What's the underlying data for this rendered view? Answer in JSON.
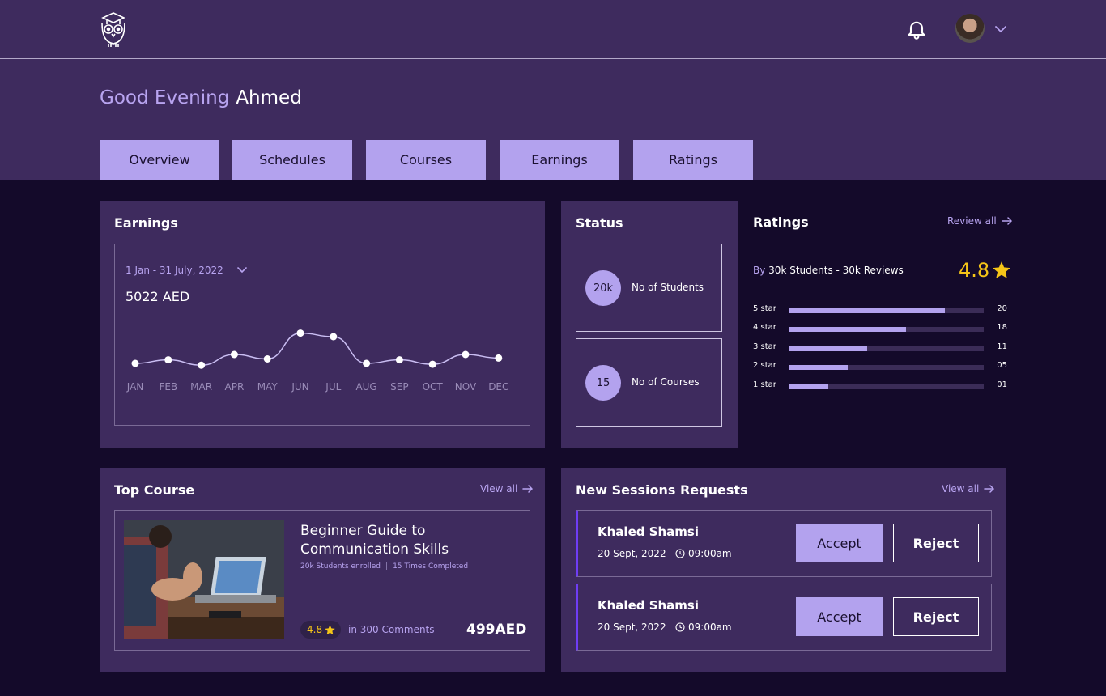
{
  "header": {
    "logo_icon": "owl-graduation-cap-logo",
    "notification_icon": "bell-icon",
    "user_menu_icon": "chevron-down-icon"
  },
  "greeting": {
    "salutation": "Good Evening",
    "name": "Ahmed"
  },
  "tabs": [
    {
      "label": "Overview"
    },
    {
      "label": "Schedules"
    },
    {
      "label": "Courses"
    },
    {
      "label": "Earnings"
    },
    {
      "label": "Ratings"
    }
  ],
  "earnings": {
    "title": "Earnings",
    "date_range": "1 Jan - 31 July, 2022",
    "total": "5022 AED"
  },
  "chart_data": {
    "type": "line",
    "title": "",
    "xlabel": "",
    "ylabel": "",
    "categories": [
      "JAN",
      "FEB",
      "MAR",
      "APR",
      "MAY",
      "JUN",
      "JUL",
      "AUG",
      "SEP",
      "OCT",
      "NOV",
      "DEC"
    ],
    "series": [
      {
        "values": [
          10,
          14,
          8,
          20,
          15,
          44,
          40,
          10,
          14,
          9,
          20,
          16
        ]
      }
    ],
    "ylim": [
      0,
      50
    ],
    "grid": false,
    "line_color": "#c9bdf2",
    "point_color": "#ffffff"
  },
  "status": {
    "title": "Status",
    "items": [
      {
        "value": "20k",
        "label": "No of Students"
      },
      {
        "value": "15",
        "label": "No of Courses"
      }
    ]
  },
  "ratings": {
    "title": "Ratings",
    "review_all": "Review all",
    "by_prefix": "By",
    "by_text": "30k Students - 30k Reviews",
    "score": "4.8",
    "rows": [
      {
        "label": "5 star",
        "fraction": 0.8,
        "count": "20"
      },
      {
        "label": "4 star",
        "fraction": 0.6,
        "count": "18"
      },
      {
        "label": "3 star",
        "fraction": 0.4,
        "count": "11"
      },
      {
        "label": "2 star",
        "fraction": 0.3,
        "count": "05"
      },
      {
        "label": "1 star",
        "fraction": 0.2,
        "count": "01"
      }
    ]
  },
  "top_course": {
    "title": "Top Course",
    "view_all": "View all",
    "course_title": "Beginner Guide to Communication Skills",
    "enrolled": "20k Students enrolled",
    "separator": "|",
    "completed": "15 Times Completed",
    "rating": "4.8",
    "comments": "in 300 Comments",
    "price": "499AED"
  },
  "sessions": {
    "title": "New Sessions Requests",
    "view_all": "View all",
    "requests": [
      {
        "name": "Khaled Shamsi",
        "date": "20 Sept, 2022",
        "time": "09:00am",
        "accept": "Accept",
        "reject": "Reject"
      },
      {
        "name": "Khaled Shamsi",
        "date": "20 Sept, 2022",
        "time": "09:00am",
        "accept": "Accept",
        "reject": "Reject"
      }
    ]
  },
  "colors": {
    "header_bg": "#3e2b5e",
    "page_bg": "#140a2a",
    "accent": "#b3a2ee",
    "accent_text": "#b8a4f0",
    "star": "#f5c518",
    "session_bar": "#6f3df5"
  }
}
